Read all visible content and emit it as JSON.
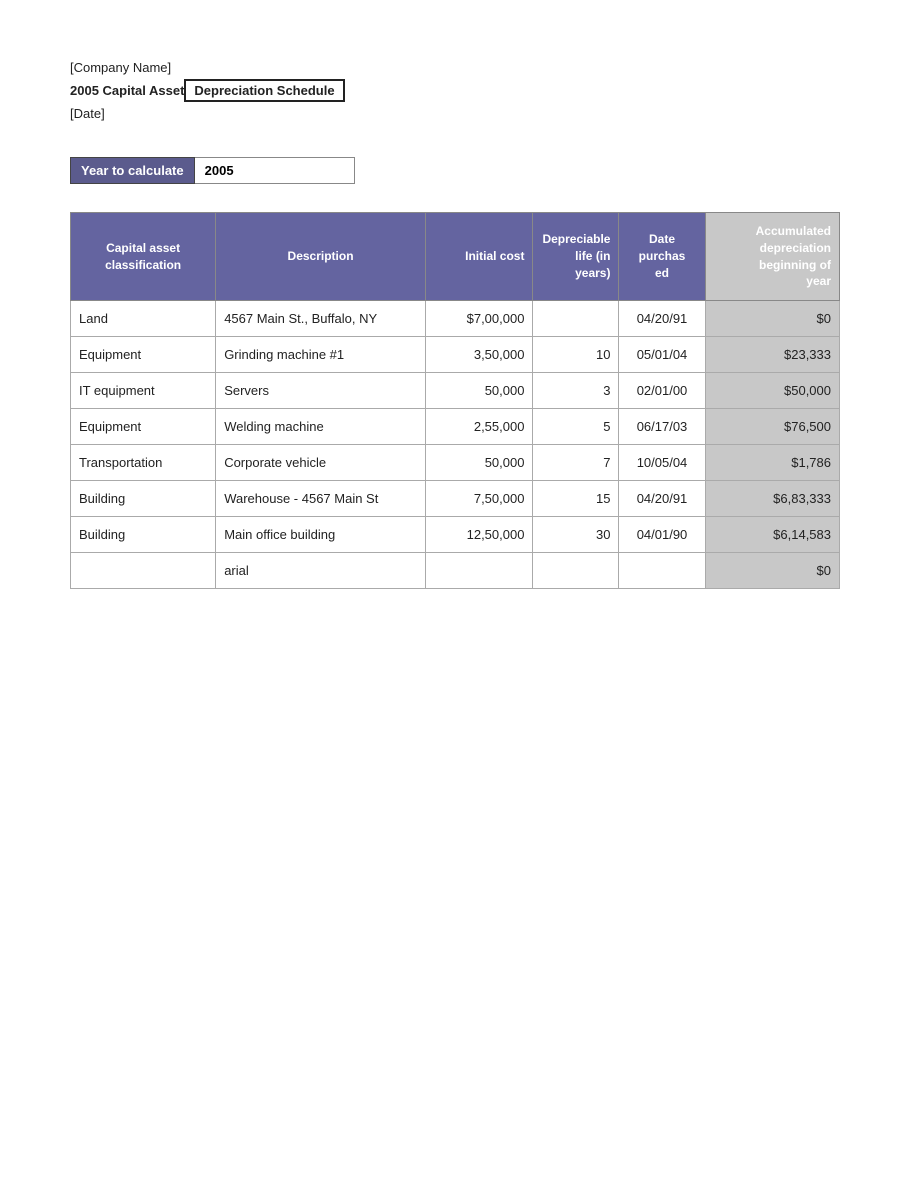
{
  "header": {
    "company_name": "[Company Name]",
    "schedule_title_part1": "2005 Capital Asset ",
    "schedule_title_box": "Depreciation Schedule",
    "date_label": "[Date]"
  },
  "year_calculator": {
    "label": "Year to calculate",
    "value": "2005"
  },
  "table": {
    "columns": [
      {
        "key": "classification",
        "label": "Capital asset\nclassification"
      },
      {
        "key": "description",
        "label": "Description"
      },
      {
        "key": "initial_cost",
        "label": "Initial cost"
      },
      {
        "key": "dep_life",
        "label": "Depreciable\nlife (in years)"
      },
      {
        "key": "date_purchased",
        "label": "Date\npurchas\ned"
      },
      {
        "key": "accum_dep",
        "label": "Accumulated\ndepreciation\nbeginning of\nyear"
      }
    ],
    "rows": [
      {
        "classification": "Land",
        "description": "4567 Main St., Buffalo, NY",
        "initial_cost": "$7,00,000",
        "dep_life": "",
        "date_purchased": "04/20/91",
        "accum_dep": "$0"
      },
      {
        "classification": "Equipment",
        "description": "Grinding machine #1",
        "initial_cost": "3,50,000",
        "dep_life": "10",
        "date_purchased": "05/01/04",
        "accum_dep": "$23,333"
      },
      {
        "classification": "IT equipment",
        "description": "Servers",
        "initial_cost": "50,000",
        "dep_life": "3",
        "date_purchased": "02/01/00",
        "accum_dep": "$50,000"
      },
      {
        "classification": "Equipment",
        "description": "Welding machine",
        "initial_cost": "2,55,000",
        "dep_life": "5",
        "date_purchased": "06/17/03",
        "accum_dep": "$76,500"
      },
      {
        "classification": "Transportation",
        "description": "Corporate vehicle",
        "initial_cost": "50,000",
        "dep_life": "7",
        "date_purchased": "10/05/04",
        "accum_dep": "$1,786"
      },
      {
        "classification": "Building",
        "description": "Warehouse - 4567 Main St",
        "initial_cost": "7,50,000",
        "dep_life": "15",
        "date_purchased": "04/20/91",
        "accum_dep": "$6,83,333"
      },
      {
        "classification": "Building",
        "description": "Main office building",
        "initial_cost": "12,50,000",
        "dep_life": "30",
        "date_purchased": "04/01/90",
        "accum_dep": "$6,14,583"
      },
      {
        "classification": "",
        "description": "arial",
        "initial_cost": "",
        "dep_life": "",
        "date_purchased": "",
        "accum_dep": "$0"
      }
    ]
  }
}
